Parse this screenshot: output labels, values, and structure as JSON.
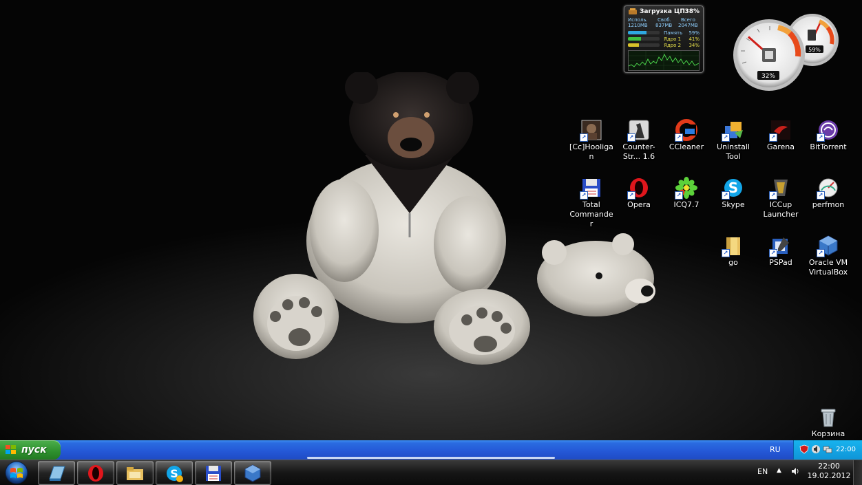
{
  "cpu_gadget": {
    "title": "Загрузка ЦП",
    "total": "38%",
    "col_used": "Исполь.",
    "col_free": "Своб.",
    "col_total": "Всего",
    "used": "1210MB",
    "free": "837MB",
    "all": "2047MB",
    "rows": [
      {
        "label": "Память",
        "value": "59%",
        "fraction": 0.59,
        "color": "#2fa8e0"
      },
      {
        "label": "Ядро 1",
        "value": "41%",
        "fraction": 0.41,
        "color": "#3fbf3f"
      },
      {
        "label": "Ядро 2",
        "value": "34%",
        "fraction": 0.34,
        "color": "#d8c22a"
      }
    ]
  },
  "gauge_gadget": {
    "cpu_value": "32%",
    "cpu_fraction": 0.32,
    "memory_value": "59%",
    "memory_fraction": 0.59
  },
  "icons": [
    {
      "label": "[Cc]Hooligan",
      "icon": "hooligan-avatar-icon"
    },
    {
      "label": "Counter-Str... 1.6",
      "icon": "counter-strike-icon"
    },
    {
      "label": "CCleaner",
      "icon": "ccleaner-icon"
    },
    {
      "label": "Uninstall Tool",
      "icon": "uninstall-tool-icon"
    },
    {
      "label": "Garena",
      "icon": "garena-icon"
    },
    {
      "label": "BitTorrent",
      "icon": "bittorrent-icon"
    },
    {
      "label": "Total Commander",
      "icon": "total-commander-icon"
    },
    {
      "label": "Opera",
      "icon": "opera-icon"
    },
    {
      "label": "ICQ7.7",
      "icon": "icq-icon"
    },
    {
      "label": "Skype",
      "icon": "skype-icon"
    },
    {
      "label": "ICCup Launcher",
      "icon": "iccup-icon"
    },
    {
      "label": "perfmon",
      "icon": "perfmon-icon"
    },
    {
      "label": "go",
      "icon": "folder-icon"
    },
    {
      "label": "PSPad",
      "icon": "pspad-icon"
    },
    {
      "label": "Oracle VM VirtualBox",
      "icon": "virtualbox-icon"
    },
    {
      "label": "Корзина",
      "icon": "recycle-bin-icon"
    }
  ],
  "xp_taskbar": {
    "start_label": "пуск",
    "lang": "RU",
    "clock": "22:00"
  },
  "win7_taskbar": {
    "lang": "EN",
    "time": "22:00",
    "date": "19.02.2012",
    "pinned": [
      "app-icon",
      "opera-icon",
      "file-manager-icon",
      "skype-icon",
      "total-commander-icon",
      "virtualbox-icon"
    ]
  }
}
